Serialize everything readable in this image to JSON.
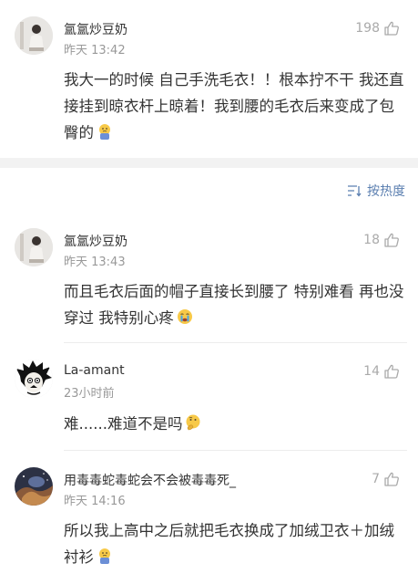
{
  "comments": [
    {
      "username": "氲氲炒豆奶",
      "time": "昨天 13:42",
      "likes": "198",
      "text": "我大一的时候 自己手洗毛衣！！根本拧不干 我还直接挂到晾衣杆上晾着！我到腰的毛衣后来变成了包臀的",
      "emoji": "crying-face"
    },
    {
      "username": "氲氲炒豆奶",
      "time": "昨天 13:43",
      "likes": "18",
      "text": "而且毛衣后面的帽子直接长到腰了 特别难看 再也没穿过 我特别心疼",
      "emoji": "sobbing-face"
    },
    {
      "username": "La-amant",
      "time": "23小时前",
      "likes": "14",
      "text": "难......难道不是吗",
      "emoji": "thinking-face"
    },
    {
      "username": "用毒毒蛇毒蛇会不会被毒毒死_",
      "time": "昨天 14:16",
      "likes": "7",
      "text": "所以我上高中之后就把毛衣换成了加绒卫衣＋加绒衬衫",
      "emoji": "crying-face"
    }
  ],
  "sort": {
    "label": "按热度"
  },
  "colors": {
    "link": "#5b7fb0",
    "meta": "#999999",
    "separator": "#f2f2f2"
  }
}
